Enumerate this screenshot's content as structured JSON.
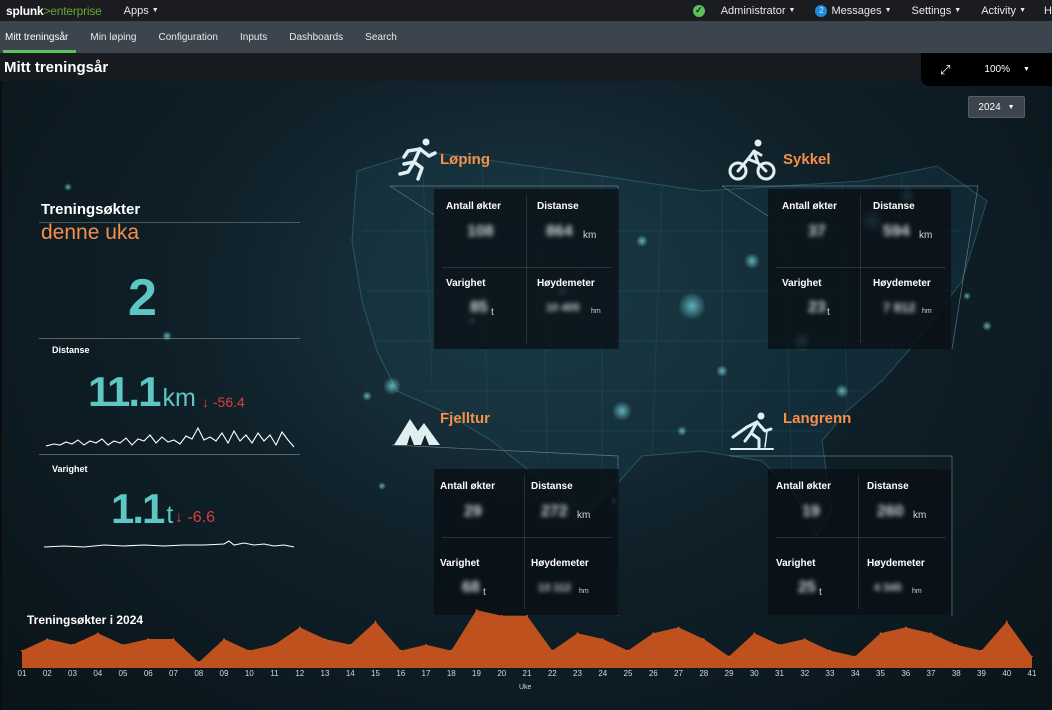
{
  "topbar": {
    "logo_brand": "splunk",
    "logo_product": ">enterprise",
    "apps": "Apps",
    "administrator": "Administrator",
    "messages_count": "2",
    "messages": "Messages",
    "settings": "Settings",
    "activity": "Activity",
    "help": "H"
  },
  "appnav": [
    "Mitt treningsår",
    "Min løping",
    "Configuration",
    "Inputs",
    "Dashboards",
    "Search"
  ],
  "page_title": "Mitt treningsår",
  "zoom": "100%",
  "year_select": "2024",
  "left_panel": {
    "title_line1": "Treningsøkter",
    "title_line2": "denne uka",
    "count": "2",
    "distance_label": "Distanse",
    "distance_value": "11.1",
    "distance_unit": "km",
    "distance_delta": "-56.4",
    "duration_label": "Varighet",
    "duration_value": "1.1",
    "duration_unit": "t",
    "duration_delta": "-6.6"
  },
  "labels": {
    "sessions": "Antall økter",
    "distance": "Distanse",
    "duration": "Varighet",
    "elevation": "Høydemeter",
    "unit_km": "km",
    "unit_t": "t",
    "unit_hm": "hm"
  },
  "sports": [
    {
      "name": "Løping",
      "sessions": "108",
      "distance": "864",
      "duration": "85",
      "elevation": "10 405"
    },
    {
      "name": "Sykkel",
      "sessions": "37",
      "distance": "594",
      "duration": "23",
      "elevation": "7 812"
    },
    {
      "name": "Fjelltur",
      "sessions": "29",
      "distance": "272",
      "duration": "68",
      "elevation": "13 112"
    },
    {
      "name": "Langrenn",
      "sessions": "19",
      "distance": "260",
      "duration": "25",
      "elevation": "4 345"
    }
  ],
  "icons": {
    "loping": "runner-icon",
    "sykkel": "cyclist-icon",
    "fjelltur": "mountain-icon",
    "langrenn": "skier-icon"
  },
  "colors": {
    "accent": "#f58f4a",
    "teal": "#5ec7c4",
    "negative": "#d93f3c",
    "area_fill": "#c8541e"
  },
  "chart_data": {
    "type": "area",
    "title": "Treningsøkter i 2024",
    "xlabel": "Uke",
    "ylabel": "",
    "x": [
      "01",
      "02",
      "03",
      "04",
      "05",
      "06",
      "07",
      "08",
      "09",
      "10",
      "11",
      "12",
      "13",
      "14",
      "15",
      "16",
      "17",
      "18",
      "19",
      "20",
      "21",
      "22",
      "23",
      "24",
      "25",
      "26",
      "27",
      "28",
      "29",
      "30",
      "31",
      "32",
      "33",
      "34",
      "35",
      "36",
      "37",
      "38",
      "39",
      "40",
      "41"
    ],
    "values": [
      3,
      5,
      4,
      6,
      4,
      5,
      5,
      1,
      5,
      3,
      4,
      7,
      5,
      4,
      8,
      3,
      4,
      3,
      10,
      9,
      9,
      3,
      6,
      5,
      3,
      6,
      7,
      5,
      2,
      6,
      4,
      5,
      3,
      2,
      6,
      7,
      6,
      4,
      3,
      8,
      2
    ]
  }
}
